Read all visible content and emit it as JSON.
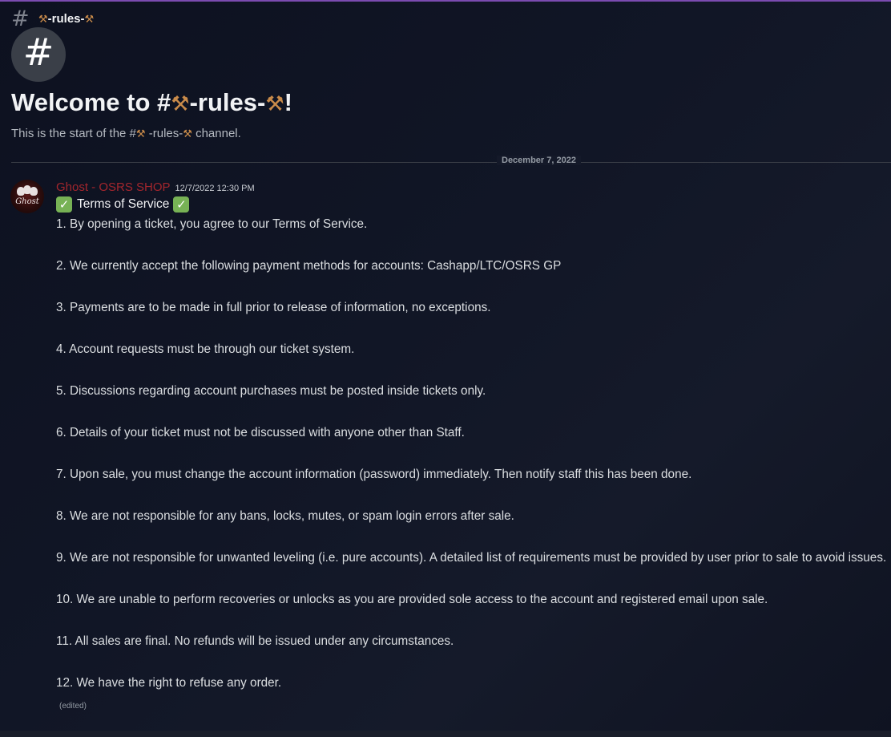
{
  "header": {
    "hash_glyph": "#",
    "channel_name": "-rules-",
    "hammer_icon": "hammer-icon"
  },
  "welcome": {
    "prefix": "Welcome to #",
    "channel_name": "-rules-",
    "suffix": "!",
    "start_prefix": "This is the start of the #",
    "start_suffix": "channel."
  },
  "divider": {
    "date": "December 7, 2022"
  },
  "message": {
    "author": "Ghost - OSRS SHOP",
    "author_color": "#a3262d",
    "timestamp": "12/7/2022 12:30 PM",
    "avatar_text": "Ghost",
    "tos_title": "Terms of Service",
    "check_icon": "white-check-mark-icon",
    "rules": [
      "1. By opening a ticket, you agree to our Terms of Service.",
      "2. We currently accept the following payment methods for accounts:  Cashapp/LTC/OSRS GP",
      "3. Payments are to be made in full prior to release of information, no exceptions.",
      "4. Account requests must be through our ticket system.",
      "5. Discussions regarding account purchases must be posted inside tickets only.",
      "6. Details of your ticket must not be discussed with anyone other than Staff.",
      "7. Upon sale, you must change the account information (password) immediately. Then notify staff this has been done.",
      "8. We are not responsible for any bans, locks, mutes, or spam login errors after sale.",
      "9. We are not responsible for unwanted leveling (i.e. pure accounts). A detailed list of requirements must be provided by user prior to sale to avoid issues.",
      "10. We are unable to perform recoveries or unlocks as you are provided sole access to the account and registered email upon sale.",
      "11. All sales are final. No refunds will be issued under any circumstances.",
      "12. We have the right to refuse any order."
    ],
    "edited_label": "(edited)"
  },
  "colors": {
    "accent_top": "#7b4bb0",
    "check_green": "#77b255"
  }
}
